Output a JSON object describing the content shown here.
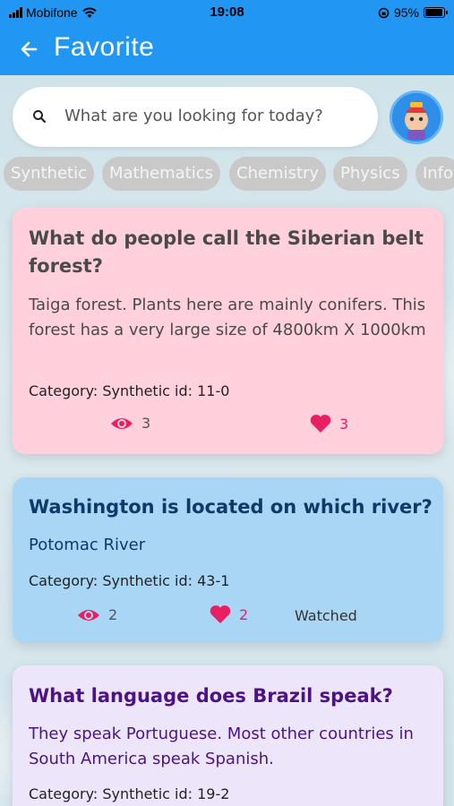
{
  "status_bar": {
    "carrier": "Mobifone",
    "time": "19:08",
    "battery": "95%",
    "icons": [
      "signal-icon",
      "wifi-icon",
      "lock-rotation-icon",
      "battery-icon"
    ]
  },
  "app_bar": {
    "title": "Favorite",
    "back_icon": "arrow-left-icon"
  },
  "search": {
    "placeholder": "What are you looking for today?",
    "icon": "search-icon"
  },
  "categories": [
    "Synthetic",
    "Mathematics",
    "Chemistry",
    "Physics",
    "Info"
  ],
  "cards": [
    {
      "question": "What do people call the Siberian belt forest?",
      "answer": "Taiga forest. Plants here are mainly conifers. This forest has a very large size of 4800km X 1000km",
      "category": "Category: Synthetic id: 11-0",
      "views": "3",
      "likes": "3",
      "watched": "",
      "color": "#ffd1dc",
      "text_color": "#4a4a4a"
    },
    {
      "question": "Washington is located on which river?",
      "answer": "Potomac River",
      "category": "Category: Synthetic id: 43-1",
      "views": "2",
      "likes": "2",
      "watched": "Watched",
      "color": "#a9d6f5",
      "text_color": "#0d3a6b"
    },
    {
      "question": "What language does Brazil speak?",
      "answer": "They speak Portuguese. Most other countries in South America speak Spanish.",
      "category": "Category: Synthetic id: 19-2",
      "views": "",
      "likes": "",
      "watched": "",
      "color": "#ede6fa",
      "text_color": "#4b1386"
    }
  ],
  "colors": {
    "primary": "#2196f3",
    "accent_pink": "#e91e63"
  }
}
